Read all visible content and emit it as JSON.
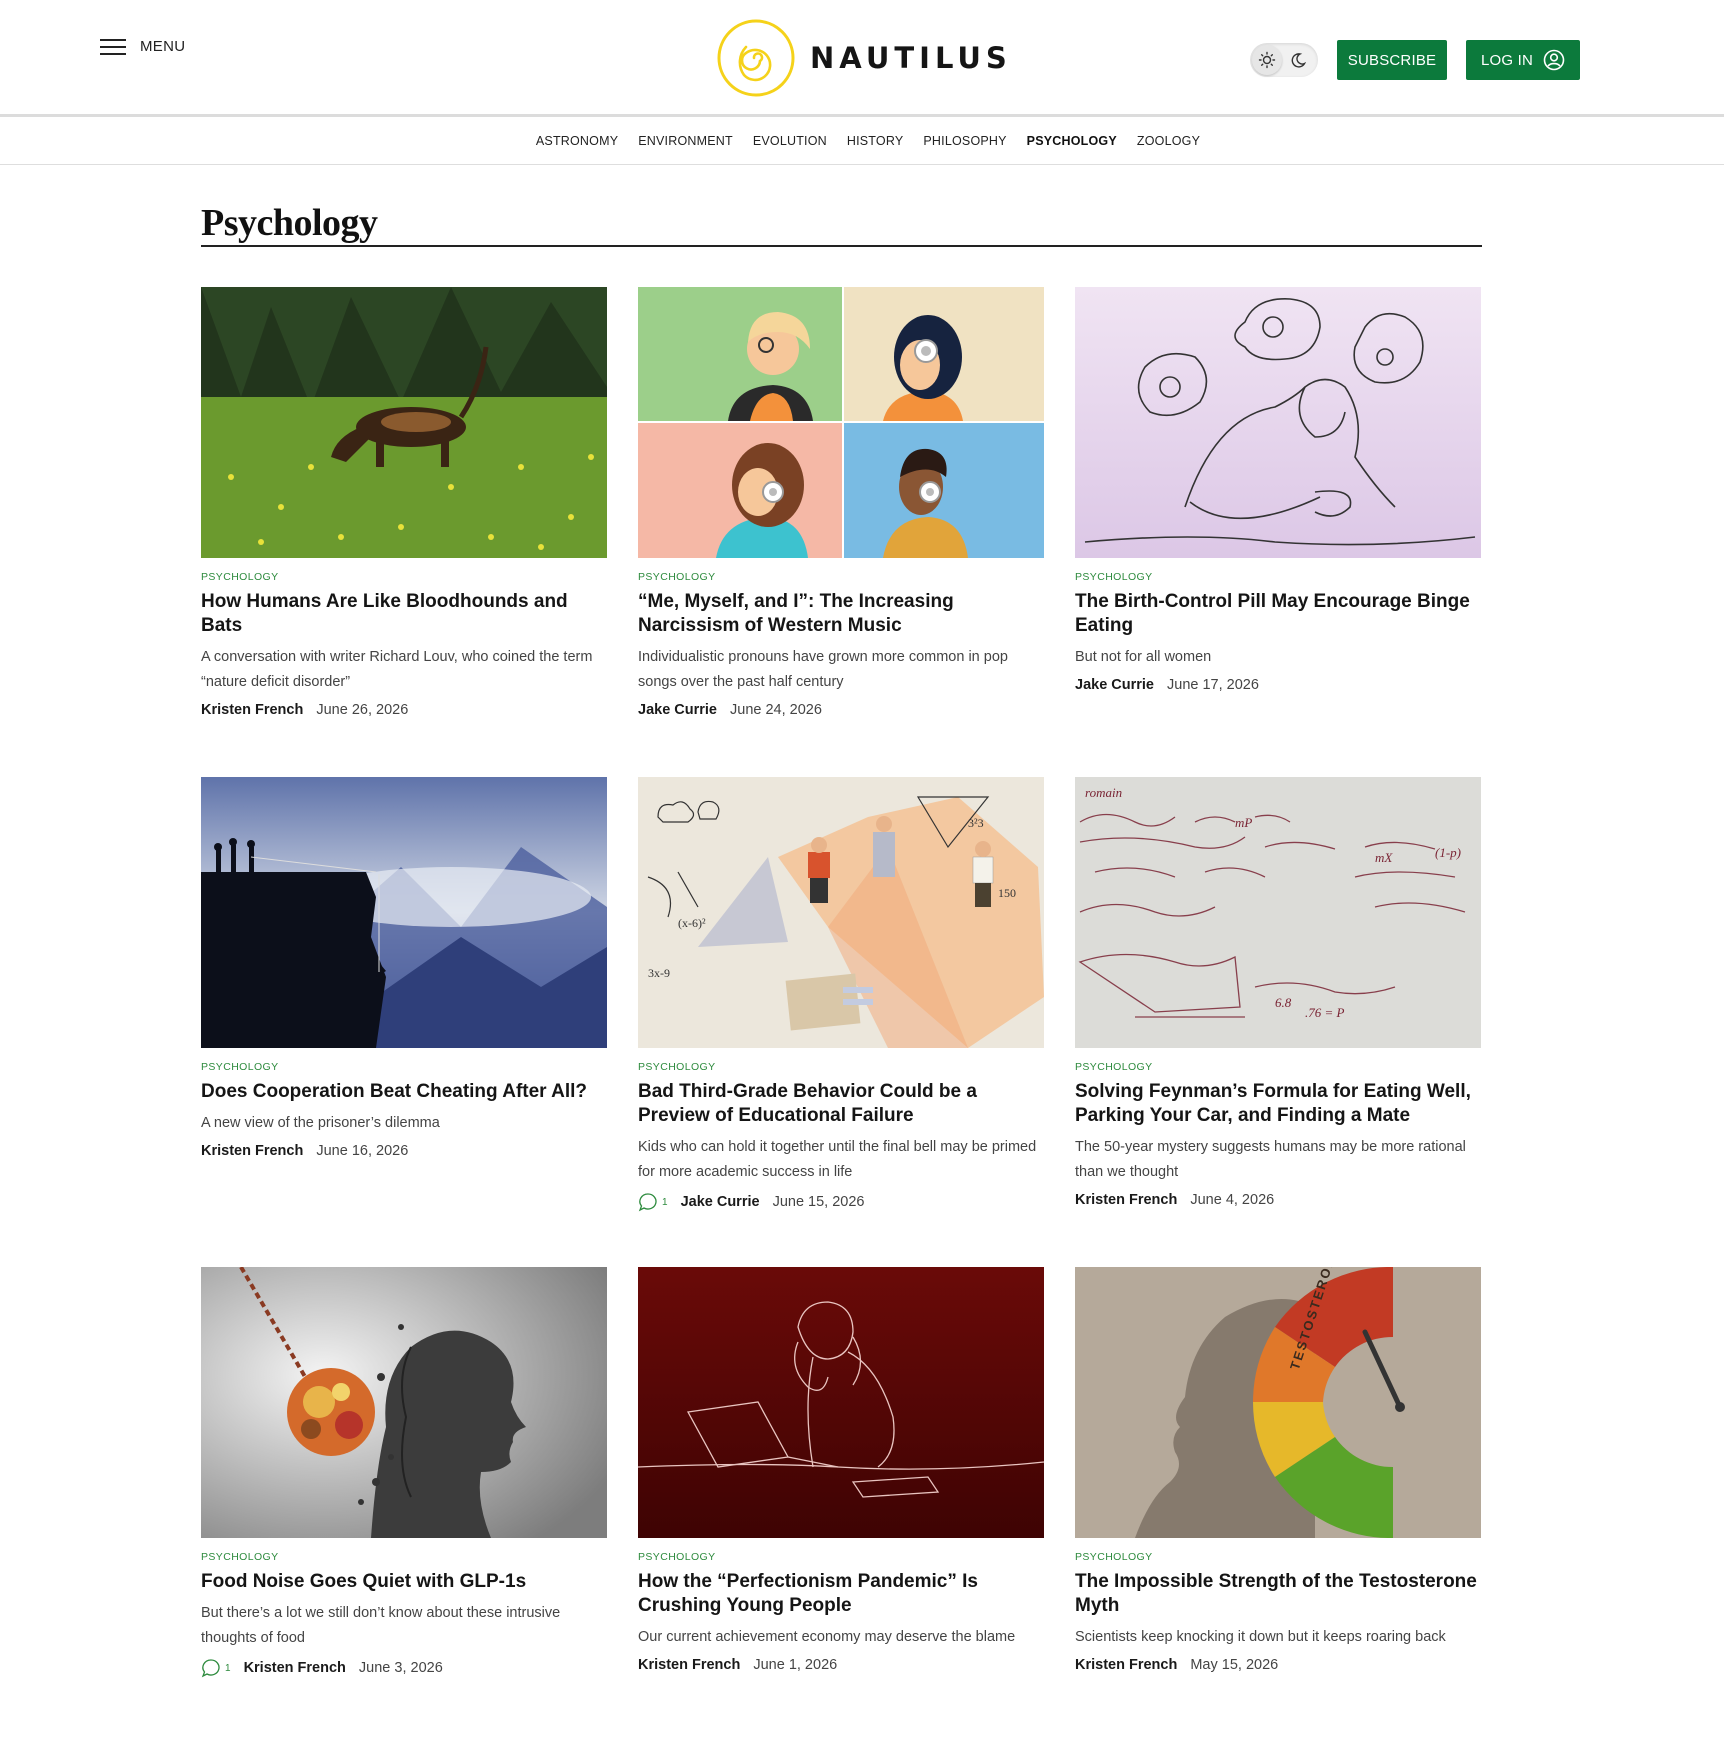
{
  "header": {
    "menu_label": "MENU",
    "brand_name": "NAUTILUS",
    "subscribe_label": "SUBSCRIBE",
    "login_label": "LOG IN",
    "accent_color": "#0c7a3c",
    "logo_color": "#f5d21a"
  },
  "topics": [
    {
      "label": "ASTRONOMY",
      "active": false
    },
    {
      "label": "ENVIRONMENT",
      "active": false
    },
    {
      "label": "EVOLUTION",
      "active": false
    },
    {
      "label": "HISTORY",
      "active": false
    },
    {
      "label": "PHILOSOPHY",
      "active": false
    },
    {
      "label": "PSYCHOLOGY",
      "active": true
    },
    {
      "label": "ZOOLOGY",
      "active": false
    }
  ],
  "page_title": "Psychology",
  "articles": [
    {
      "category": "PSYCHOLOGY",
      "title": "How Humans Are Like Bloodhounds and Bats",
      "dek": "A conversation with writer Richard Louv, who coined the term “nature deficit disorder”",
      "author": "Kristen French",
      "date": "June 26, 2026",
      "comments": null,
      "image": "bloodhound-in-meadow"
    },
    {
      "category": "PSYCHOLOGY",
      "title": "“Me, Myself, and I”: The Increasing Narcissism of Western Music",
      "dek": "Individualistic pronouns have grown more common in pop songs over the past half century",
      "author": "Jake Currie",
      "date": "June 24, 2026",
      "comments": null,
      "image": "four-people-with-headphones"
    },
    {
      "category": "PSYCHOLOGY",
      "title": "The Birth-Control Pill May Encourage Binge Eating",
      "dek": "But not for all women",
      "author": "Jake Currie",
      "date": "June 17, 2026",
      "comments": null,
      "image": "woman-thinking-of-food"
    },
    {
      "category": "PSYCHOLOGY",
      "title": "Does Cooperation Beat Cheating After All?",
      "dek": "A new view of the prisoner’s dilemma",
      "author": "Kristen French",
      "date": "June 16, 2026",
      "comments": null,
      "image": "climbers-on-cliff"
    },
    {
      "category": "PSYCHOLOGY",
      "title": "Bad Third-Grade Behavior Could be a Preview of Educational Failure",
      "dek": "Kids who can hold it together until the final bell may be primed for more academic success in life",
      "author": "Jake Currie",
      "date": "June 15, 2026",
      "comments": "1",
      "image": "children-collage"
    },
    {
      "category": "PSYCHOLOGY",
      "title": "Solving Feynman’s Formula for Eating Well, Parking Your Car, and Finding a Mate",
      "dek": "The 50-year mystery suggests humans may be more rational than we thought",
      "author": "Kristen French",
      "date": "June 4, 2026",
      "comments": null,
      "image": "handwritten-formulas"
    },
    {
      "category": "PSYCHOLOGY",
      "title": "Food Noise Goes Quiet with GLP-1s",
      "dek": "But there’s a lot we still don’t know about these intrusive thoughts of food",
      "author": "Kristen French",
      "date": "June 3, 2026",
      "comments": "1",
      "image": "head-hit-by-food-wrecking-ball"
    },
    {
      "category": "PSYCHOLOGY",
      "title": "How the “Perfectionism Pandemic” Is Crushing Young People",
      "dek": "Our current achievement economy may deserve the blame",
      "author": "Kristen French",
      "date": "June 1, 2026",
      "comments": null,
      "image": "stressed-person-line-drawing"
    },
    {
      "category": "PSYCHOLOGY",
      "title": "The Impossible Strength of the Testosterone Myth",
      "dek": "Scientists keep knocking it down but it keeps roaring back",
      "author": "Kristen French",
      "date": "May 15, 2026",
      "comments": null,
      "image": "testosterone-gauge",
      "image_text": "TESTOSTERONE"
    }
  ]
}
